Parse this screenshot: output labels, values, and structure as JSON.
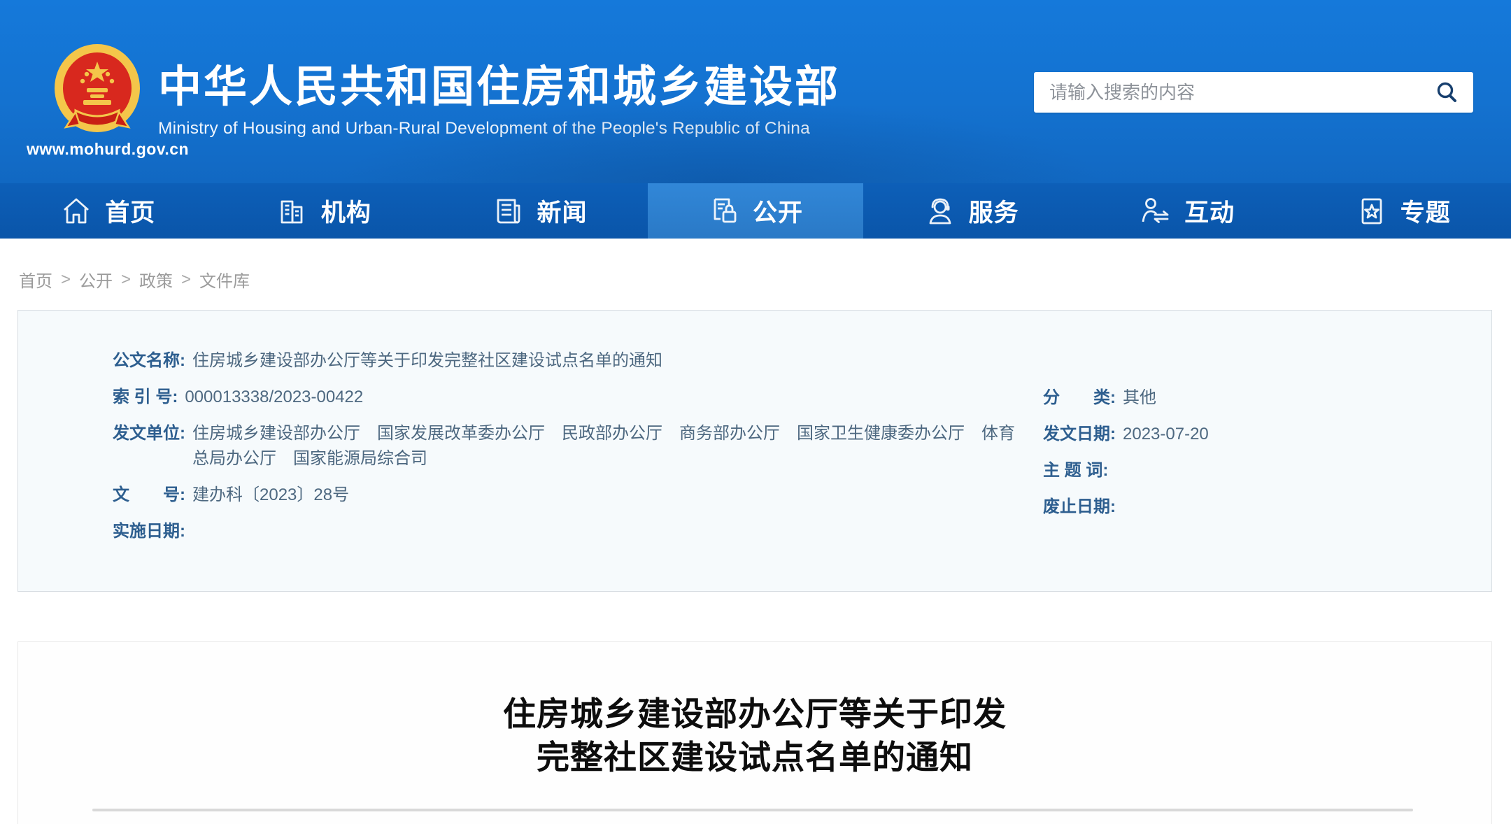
{
  "colors": {
    "header_blue": "#1474d2",
    "nav_blue": "#0b58b0",
    "active_tab_blue": "#2c7ecf",
    "meta_label_blue": "#2d5e8f",
    "meta_value_blue_gray": "#4d6880",
    "breadcrumb_gray": "#9b9b9b",
    "emblem_red": "#d8281e",
    "emblem_gold": "#f4c64a",
    "article_title_black": "#0d0d0d"
  },
  "header": {
    "site_url": "www.mohurd.gov.cn",
    "title_cn": "中华人民共和国住房和城乡建设部",
    "title_en": "Ministry of Housing and Urban-Rural Development of the People's Republic of China",
    "search": {
      "placeholder": "请输入搜索的内容",
      "icon": "search-icon"
    }
  },
  "nav": {
    "items": [
      {
        "label": "首页",
        "icon": "home-icon",
        "active": false
      },
      {
        "label": "机构",
        "icon": "building-icon",
        "active": false
      },
      {
        "label": "新闻",
        "icon": "news-icon",
        "active": false
      },
      {
        "label": "公开",
        "icon": "open-document-icon",
        "active": true
      },
      {
        "label": "服务",
        "icon": "service-agent-icon",
        "active": false
      },
      {
        "label": "互动",
        "icon": "interaction-icon",
        "active": false
      },
      {
        "label": "专题",
        "icon": "star-topic-icon",
        "active": false
      }
    ]
  },
  "breadcrumb": {
    "separator": ">",
    "items": [
      "首页",
      "公开",
      "政策",
      "文件库"
    ]
  },
  "doc_meta": {
    "left_rows": [
      {
        "label": "公文名称:",
        "value": "住房城乡建设部办公厅等关于印发完整社区建设试点名单的通知"
      },
      {
        "label": "索 引 号:",
        "value": "000013338/2023-00422"
      },
      {
        "label": "发文单位:",
        "value": "住房城乡建设部办公厅　国家发展改革委办公厅　民政部办公厅　商务部办公厅　国家卫生健康委办公厅　体育总局办公厅　国家能源局综合司"
      },
      {
        "label": "文　　号:",
        "value": "建办科〔2023〕28号"
      },
      {
        "label": "实施日期:",
        "value": ""
      }
    ],
    "right_rows": [
      {
        "label": "分　　类:",
        "value": "其他"
      },
      {
        "label": "发文日期:",
        "value": "2023-07-20"
      },
      {
        "label": "主 题 词:",
        "value": ""
      },
      {
        "label": "废止日期:",
        "value": ""
      }
    ]
  },
  "article": {
    "title_line1": "住房城乡建设部办公厅等关于印发",
    "title_line2": "完整社区建设试点名单的通知"
  }
}
